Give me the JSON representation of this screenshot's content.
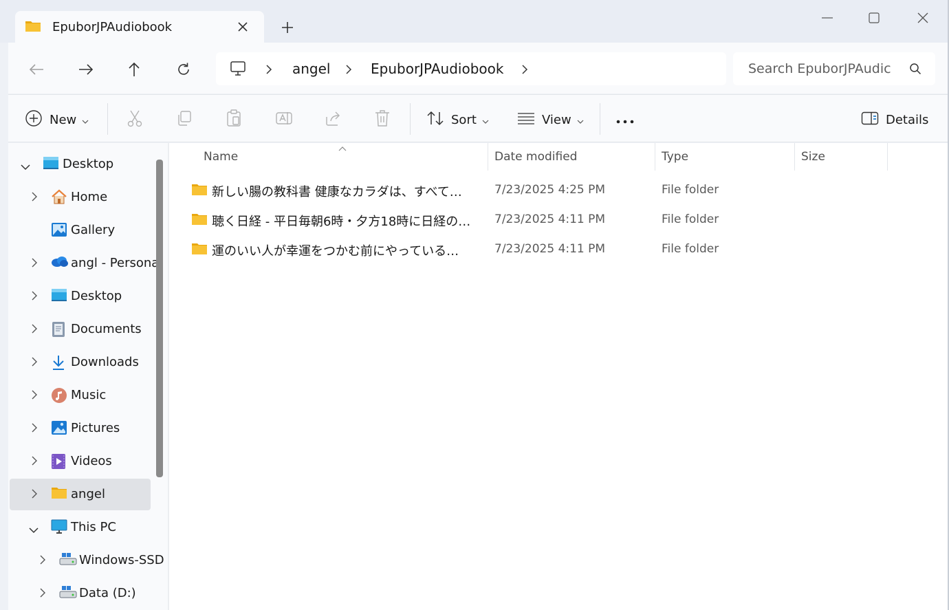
{
  "window": {
    "tab_title": "EpuborJPAudiobook",
    "new_tab_label": "+"
  },
  "address": {
    "crumbs": [
      "angel",
      "EpuborJPAudiobook"
    ]
  },
  "search": {
    "placeholder": "Search EpuborJPAudic"
  },
  "toolbar": {
    "new_label": "New",
    "sort_label": "Sort",
    "view_label": "View",
    "more_label": "•••",
    "details_label": "Details"
  },
  "sidebar": {
    "items": [
      {
        "label": "Desktop",
        "icon": "desktop-icon",
        "expander": "expanded"
      },
      {
        "label": "Home",
        "icon": "home-icon",
        "expander": "collapsed"
      },
      {
        "label": "Gallery",
        "icon": "gallery-icon",
        "expander": "none"
      },
      {
        "label": "angl - Personal",
        "icon": "onedrive-icon",
        "expander": "collapsed"
      },
      {
        "label": "Desktop",
        "icon": "desktop-icon",
        "expander": "collapsed"
      },
      {
        "label": "Documents",
        "icon": "documents-icon",
        "expander": "collapsed"
      },
      {
        "label": "Downloads",
        "icon": "downloads-icon",
        "expander": "collapsed"
      },
      {
        "label": "Music",
        "icon": "music-icon",
        "expander": "collapsed"
      },
      {
        "label": "Pictures",
        "icon": "pictures-icon",
        "expander": "collapsed"
      },
      {
        "label": "Videos",
        "icon": "videos-icon",
        "expander": "collapsed"
      },
      {
        "label": "angel",
        "icon": "folder-icon",
        "expander": "collapsed",
        "selected": true
      },
      {
        "label": "This PC",
        "icon": "this-pc-icon",
        "expander": "expanded"
      },
      {
        "label": "Windows-SSD",
        "icon": "drive-icon",
        "expander": "collapsed"
      },
      {
        "label": "Data (D:)",
        "icon": "drive-icon",
        "expander": "collapsed"
      }
    ]
  },
  "columns": {
    "name": "Name",
    "date": "Date modified",
    "type": "Type",
    "size": "Size"
  },
  "files": [
    {
      "name": "新しい腸の教科書 健康なカラダは、すべて…",
      "date": "7/23/2025 4:25 PM",
      "type": "File folder"
    },
    {
      "name": "聴く日経 - 平日毎朝6時・夕方18時に日経の…",
      "date": "7/23/2025 4:11 PM",
      "type": "File folder"
    },
    {
      "name": "運のいい人が幸運をつかむ前にやっている…",
      "date": "7/23/2025 4:11 PM",
      "type": "File folder"
    }
  ],
  "colors": {
    "folder": "#f8c234",
    "accent": "#0067c0"
  }
}
